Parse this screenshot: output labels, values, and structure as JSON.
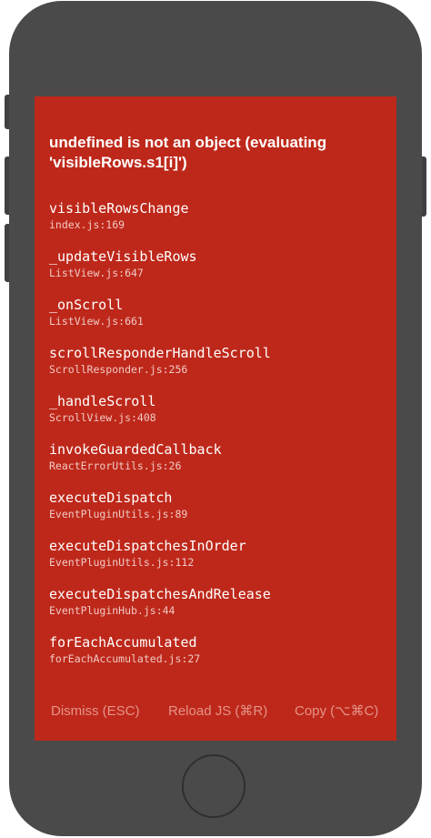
{
  "error": {
    "message": "undefined is not an object (evaluating 'visibleRows.s1[i]')"
  },
  "stack": [
    {
      "method": "visibleRowsChange",
      "file": "index.js:169"
    },
    {
      "method": "_updateVisibleRows",
      "file": "ListView.js:647"
    },
    {
      "method": "_onScroll",
      "file": "ListView.js:661"
    },
    {
      "method": "scrollResponderHandleScroll",
      "file": "ScrollResponder.js:256"
    },
    {
      "method": "_handleScroll",
      "file": "ScrollView.js:408"
    },
    {
      "method": "invokeGuardedCallback",
      "file": "ReactErrorUtils.js:26"
    },
    {
      "method": "executeDispatch",
      "file": "EventPluginUtils.js:89"
    },
    {
      "method": "executeDispatchesInOrder",
      "file": "EventPluginUtils.js:112"
    },
    {
      "method": "executeDispatchesAndRelease",
      "file": "EventPluginHub.js:44"
    },
    {
      "method": "forEachAccumulated",
      "file": "forEachAccumulated.js:27"
    }
  ],
  "actions": {
    "dismiss": "Dismiss (ESC)",
    "reload": "Reload JS (⌘R)",
    "copy": "Copy (⌥⌘C)"
  },
  "colors": {
    "background": "#be281a",
    "device_body": "#4a4a4a",
    "action_text": "#e49389"
  }
}
